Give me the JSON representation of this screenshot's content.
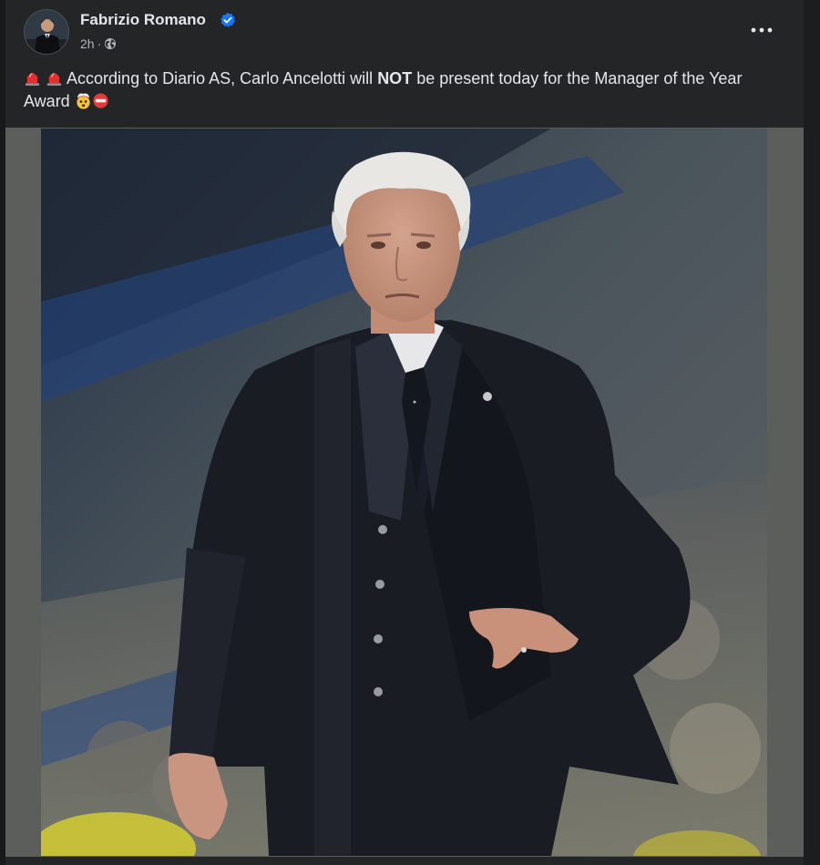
{
  "post": {
    "author": "Fabrizio Romano",
    "verified": true,
    "time": "2h",
    "separator": "·",
    "privacy_icon": "globe-icon",
    "more_icon": "more-dots-icon",
    "text": {
      "emojis_lead": "siren-emoji siren-emoji",
      "before_bold": "According to Diario AS, Carlo Ancelotti will ",
      "bold": "NOT",
      "after_bold": " be present today for the Manager of the Year Award",
      "emojis_trail": "exploding-head-emoji no-entry-emoji"
    }
  },
  "colors": {
    "background": "#18191a",
    "card": "#242526",
    "text_primary": "#e4e6eb",
    "text_secondary": "#b0b3b8",
    "verified_blue": "#1877f2",
    "media_frame": "#5b5e5b"
  }
}
